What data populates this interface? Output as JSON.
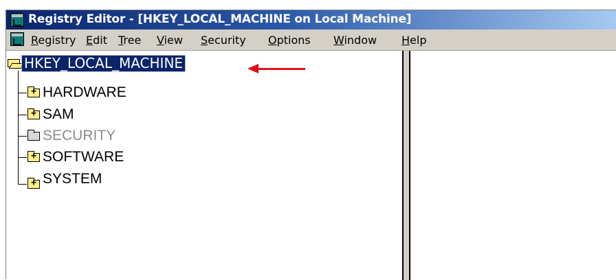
{
  "window": {
    "title": "Registry Editor - [HKEY_LOCAL_MACHINE on Local Machine]"
  },
  "menu": {
    "items": [
      {
        "label": "Registry"
      },
      {
        "label": "Edit"
      },
      {
        "label": "Tree"
      },
      {
        "label": "View"
      },
      {
        "label": "Security"
      },
      {
        "label": "Options"
      },
      {
        "label": "Window"
      },
      {
        "label": "Help"
      }
    ]
  },
  "tree": {
    "root": {
      "label": "HKEY_LOCAL_MACHINE",
      "selected": true
    },
    "children": [
      {
        "label": "HARDWARE",
        "expandable": true,
        "disabled": false
      },
      {
        "label": "SAM",
        "expandable": true,
        "disabled": false
      },
      {
        "label": "SECURITY",
        "expandable": false,
        "disabled": true
      },
      {
        "label": "SOFTWARE",
        "expandable": true,
        "disabled": false
      },
      {
        "label": "SYSTEM",
        "expandable": true,
        "disabled": false
      }
    ]
  },
  "annotation": {
    "color": "#e0101a",
    "icon": "red-arrow-icon"
  },
  "colors": {
    "title_start": "#0a246a",
    "title_end": "#a6caf0",
    "selection": "#0a246a",
    "chrome": "#d4d0c8"
  }
}
